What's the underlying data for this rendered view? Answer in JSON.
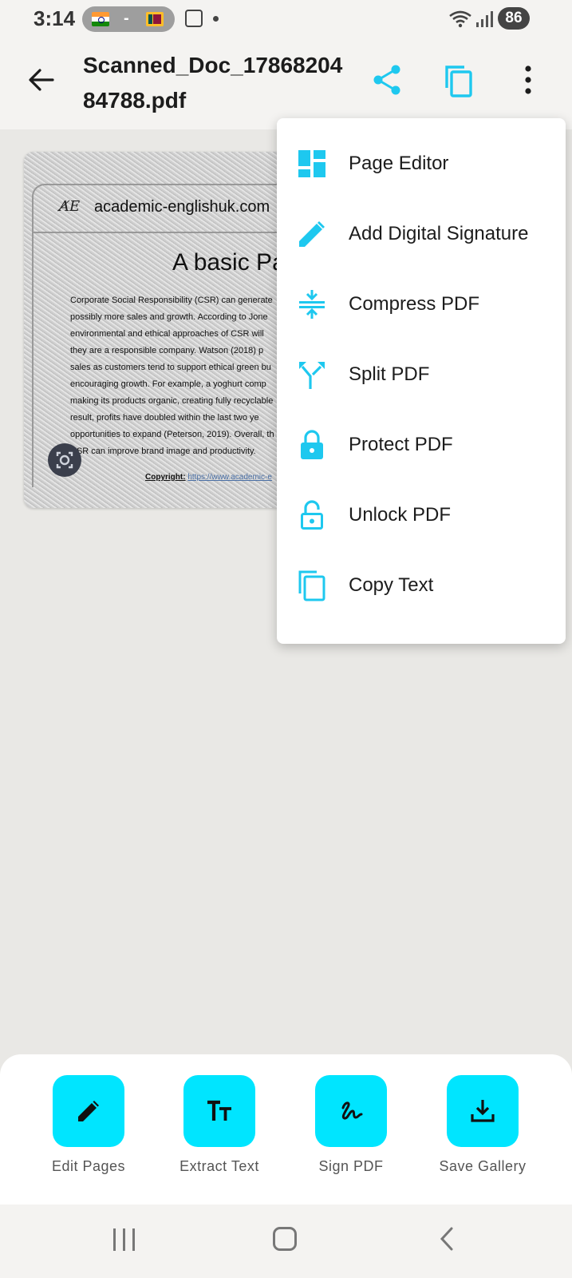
{
  "status_bar": {
    "time": "3:14",
    "separator": "-",
    "battery": "86"
  },
  "header": {
    "title": "Scanned_Doc_1786820484788.pdf"
  },
  "document": {
    "logo_text": "A̸E",
    "site": "academic-englishuk.com",
    "heading": "A basic Pa",
    "lines": [
      "Corporate Social Responsibility (CSR) can generate",
      "possibly more sales and growth. According to Jone",
      "environmental and ethical approaches of CSR will",
      "they are a responsible company. Watson (2018) p",
      "sales as customers tend to support ethical green bu",
      "encouraging growth. For example, a yoghurt comp",
      "making its products organic, creating fully recyclable",
      "result, profits have doubled within the last two ye",
      "opportunities to expand (Peterson, 2019). Overall, th",
      "CSR can improve brand image and productivity."
    ],
    "copyright_label": "Copyright:",
    "copyright_link": "https://www.academic-e"
  },
  "menu": {
    "items": [
      {
        "label": "Page Editor",
        "icon": "page-editor-icon"
      },
      {
        "label": "Add Digital Signature",
        "icon": "pencil-icon"
      },
      {
        "label": "Compress PDF",
        "icon": "compress-icon"
      },
      {
        "label": "Split PDF",
        "icon": "split-icon"
      },
      {
        "label": "Protect PDF",
        "icon": "lock-icon"
      },
      {
        "label": "Unlock PDF",
        "icon": "unlock-icon"
      },
      {
        "label": "Copy Text",
        "icon": "copy-icon"
      }
    ]
  },
  "actions": [
    {
      "label": "Edit Pages",
      "icon": "pencil-icon"
    },
    {
      "label": "Extract Text",
      "icon": "text-format-icon"
    },
    {
      "label": "Sign PDF",
      "icon": "signature-icon"
    },
    {
      "label": "Save Gallery",
      "icon": "download-icon"
    }
  ],
  "colors": {
    "accent": "#00e5ff",
    "icon_accent": "#1ec8ef",
    "background": "#e9e8e5",
    "bar": "#f4f3f1"
  }
}
